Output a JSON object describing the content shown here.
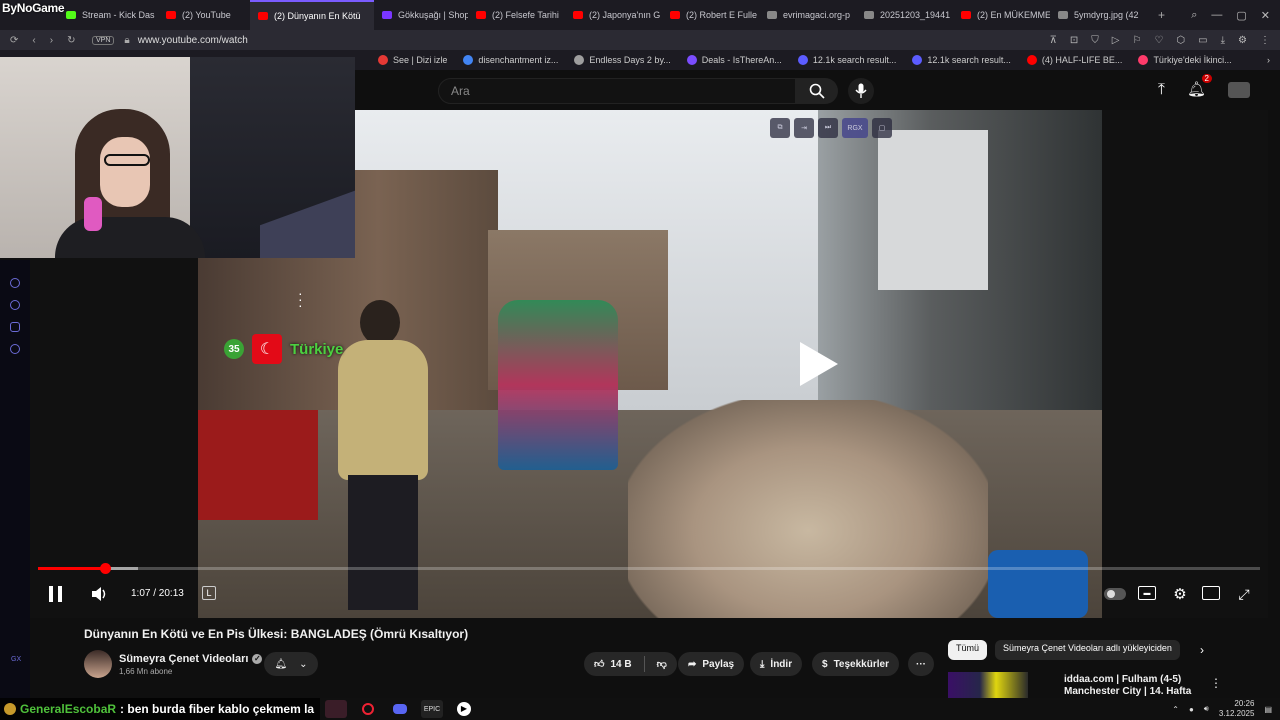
{
  "brand_overlay": "ByNoGame",
  "browser": {
    "tabs": [
      {
        "label": "Stream - Kick Das",
        "color": "#53fc18"
      },
      {
        "label": "(2) YouTube",
        "color": "#ff0000"
      },
      {
        "label": "(2) Dünyanın En Kötü",
        "color": "#ff0000",
        "active": true
      },
      {
        "label": "Gökkuşağı | Shop",
        "color": "#7a36ff"
      },
      {
        "label": "(2) Felsefe Tarihi",
        "color": "#ff0000"
      },
      {
        "label": "(2) Japonya'nın G",
        "color": "#ff0000"
      },
      {
        "label": "(2) Robert E Fulle",
        "color": "#ff0000"
      },
      {
        "label": "evrimagaci.org-p",
        "color": "#888888"
      },
      {
        "label": "20251203_19441",
        "color": "#888888"
      },
      {
        "label": "(2) En MÜKEMME",
        "color": "#ff0000"
      },
      {
        "label": "5ymdyrg.jpg (42",
        "color": "#888888"
      }
    ],
    "new_tab": "+",
    "vpn_label": "VPN",
    "url": "www.youtube.com/watch",
    "bookmarks": [
      {
        "label": "See | Dizi izle",
        "color": "#e53935"
      },
      {
        "label": "disenchantment iz...",
        "color": "#4285f4"
      },
      {
        "label": "Endless Days 2 by...",
        "color": "#9e9e9e"
      },
      {
        "label": "Deals - IsThereAn...",
        "color": "#7b4dff"
      },
      {
        "label": "12.1k search result...",
        "color": "#5c5cff"
      },
      {
        "label": "12.1k search result...",
        "color": "#5c5cff"
      },
      {
        "label": "(4) HALF-LIFE BE...",
        "color": "#ff0000"
      },
      {
        "label": "Türkiye'deki İkinci...",
        "color": "#ff3b6b"
      }
    ],
    "bookmarks_more": "›"
  },
  "youtube": {
    "search_placeholder": "Ara",
    "notifications_count": "2"
  },
  "player": {
    "overlay_rank": "35",
    "overlay_country": "Türkiye",
    "overlay_flag": "☾",
    "time_display": "1:07 / 20:13",
    "progress_fraction": 0.055,
    "buffer_fraction": 0.082,
    "top_controls": [
      "⧉",
      "⇥",
      "⏭",
      "RGX",
      "▢"
    ]
  },
  "video": {
    "title": "Dünyanın En Kötü ve En Pis Ülkesi: BANGLADEŞ (Ömrü Kısaltıyor)",
    "channel_name": "Sümeyra Çenet Videoları",
    "subscribers": "1,66 Mn abone",
    "likes": "14 B",
    "share_label": "Paylaş",
    "download_label": "İndir",
    "thanks_label": "Teşekkürler"
  },
  "sidebar_chips": {
    "all": "Tümü",
    "uploader": "Sümeyra Çenet Videoları adlı yükleyiciden"
  },
  "recommended": {
    "title": "iddaa.com | Fulham (4-5) Manchester City | 14. Hafta"
  },
  "chat_ticker": {
    "user": "GeneralEscobaR",
    "message": ": ben burda fiber kablo çekmem la"
  },
  "clock": {
    "time": "20:26",
    "date": "3.12.2025"
  }
}
